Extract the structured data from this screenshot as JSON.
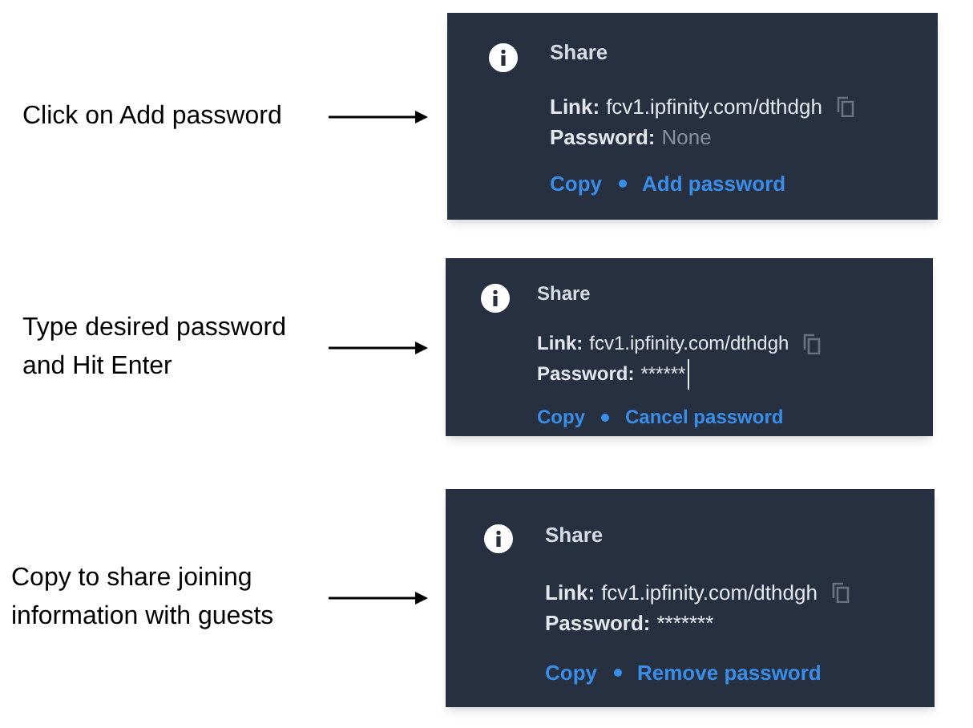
{
  "steps": [
    {
      "instruction": "Click on Add password",
      "panel": {
        "title": "Share",
        "link_label": "Link:",
        "link": "fcv1.ipfinity.com/dthdgh",
        "password_label": "Password:",
        "password_value": "None",
        "value_muted": true,
        "cursor": false,
        "actions": [
          "Copy",
          "Add password"
        ]
      }
    },
    {
      "instruction": "Type desired password\nand Hit Enter",
      "panel": {
        "title": "Share",
        "link_label": "Link:",
        "link": "fcv1.ipfinity.com/dthdgh",
        "password_label": "Password:",
        "password_value": "******",
        "value_muted": false,
        "cursor": true,
        "actions": [
          "Copy",
          "Cancel password"
        ]
      }
    },
    {
      "instruction": "Copy to share joining\ninformation with guests",
      "panel": {
        "title": "Share",
        "link_label": "Link:",
        "link": "fcv1.ipfinity.com/dthdgh",
        "password_label": "Password:",
        "password_value": "*******",
        "value_muted": false,
        "cursor": false,
        "actions": [
          "Copy",
          "Remove password"
        ]
      }
    }
  ]
}
